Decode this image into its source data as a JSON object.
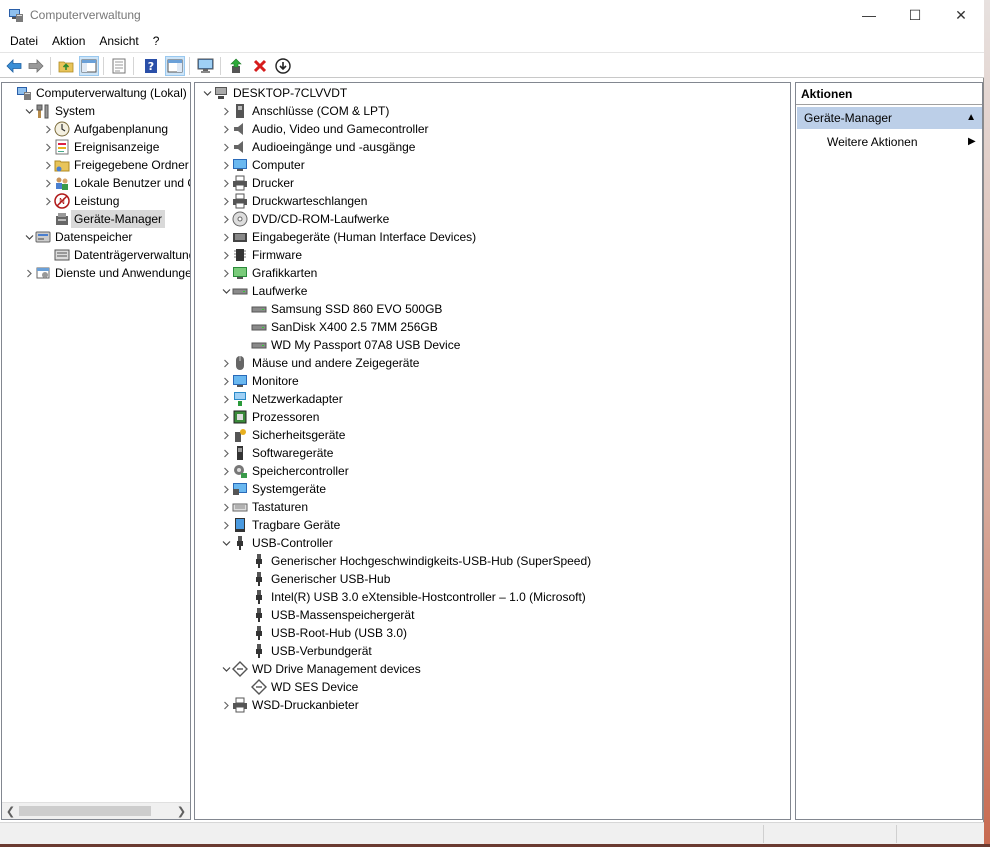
{
  "window": {
    "title": "Computerverwaltung",
    "minimize": "—",
    "maximize": "☐",
    "close": "✕"
  },
  "menu": [
    "Datei",
    "Aktion",
    "Ansicht",
    "?"
  ],
  "left_tree": [
    {
      "label": "Computerverwaltung (Lokal)",
      "icon": "computer-management-icon",
      "expander": "",
      "depth": 0
    },
    {
      "label": "System",
      "icon": "tools-icon",
      "expander": "open",
      "depth": 1
    },
    {
      "label": "Aufgabenplanung",
      "icon": "clock-icon",
      "expander": "closed",
      "depth": 2
    },
    {
      "label": "Ereignisanzeige",
      "icon": "event-viewer-icon",
      "expander": "closed",
      "depth": 2
    },
    {
      "label": "Freigegebene Ordner",
      "icon": "shared-folder-icon",
      "expander": "closed",
      "depth": 2
    },
    {
      "label": "Lokale Benutzer und Gruppen",
      "icon": "users-icon",
      "expander": "closed",
      "depth": 2
    },
    {
      "label": "Leistung",
      "icon": "performance-icon",
      "expander": "closed",
      "depth": 2
    },
    {
      "label": "Geräte-Manager",
      "icon": "device-manager-icon",
      "expander": "",
      "depth": 2,
      "selected": true
    },
    {
      "label": "Datenspeicher",
      "icon": "storage-icon",
      "expander": "open",
      "depth": 1
    },
    {
      "label": "Datenträgerverwaltung",
      "icon": "disk-management-icon",
      "expander": "",
      "depth": 2
    },
    {
      "label": "Dienste und Anwendungen",
      "icon": "services-icon",
      "expander": "closed",
      "depth": 1
    }
  ],
  "device_tree": [
    {
      "label": "DESKTOP-7CLVVDT",
      "icon": "computer-root-icon",
      "expander": "open",
      "depth": 0
    },
    {
      "label": "Anschlüsse (COM & LPT)",
      "icon": "port-icon",
      "expander": "closed",
      "depth": 1
    },
    {
      "label": "Audio, Video und Gamecontroller",
      "icon": "speaker-icon",
      "expander": "closed",
      "depth": 1
    },
    {
      "label": "Audioeingänge und -ausgänge",
      "icon": "speaker-icon",
      "expander": "closed",
      "depth": 1
    },
    {
      "label": "Computer",
      "icon": "monitor-icon",
      "expander": "closed",
      "depth": 1
    },
    {
      "label": "Drucker",
      "icon": "printer-icon",
      "expander": "closed",
      "depth": 1
    },
    {
      "label": "Druckwarteschlangen",
      "icon": "printer-icon",
      "expander": "closed",
      "depth": 1
    },
    {
      "label": "DVD/CD-ROM-Laufwerke",
      "icon": "dvd-icon",
      "expander": "closed",
      "depth": 1
    },
    {
      "label": "Eingabegeräte (Human Interface Devices)",
      "icon": "hid-icon",
      "expander": "closed",
      "depth": 1
    },
    {
      "label": "Firmware",
      "icon": "chip-icon",
      "expander": "closed",
      "depth": 1
    },
    {
      "label": "Grafikkarten",
      "icon": "display-adapter-icon",
      "expander": "closed",
      "depth": 1
    },
    {
      "label": "Laufwerke",
      "icon": "drive-icon",
      "expander": "open",
      "depth": 1
    },
    {
      "label": "Samsung SSD 860 EVO 500GB",
      "icon": "drive-icon",
      "expander": "",
      "depth": 2
    },
    {
      "label": "SanDisk X400 2.5 7MM 256GB",
      "icon": "drive-icon",
      "expander": "",
      "depth": 2
    },
    {
      "label": "WD My Passport 07A8 USB Device",
      "icon": "drive-icon",
      "expander": "",
      "depth": 2
    },
    {
      "label": "Mäuse und andere Zeigegeräte",
      "icon": "mouse-icon",
      "expander": "closed",
      "depth": 1
    },
    {
      "label": "Monitore",
      "icon": "monitor-icon",
      "expander": "closed",
      "depth": 1
    },
    {
      "label": "Netzwerkadapter",
      "icon": "network-icon",
      "expander": "closed",
      "depth": 1
    },
    {
      "label": "Prozessoren",
      "icon": "processor-icon",
      "expander": "closed",
      "depth": 1
    },
    {
      "label": "Sicherheitsgeräte",
      "icon": "security-icon",
      "expander": "closed",
      "depth": 1
    },
    {
      "label": "Softwaregeräte",
      "icon": "software-device-icon",
      "expander": "closed",
      "depth": 1
    },
    {
      "label": "Speichercontroller",
      "icon": "storage-controller-icon",
      "expander": "closed",
      "depth": 1
    },
    {
      "label": "Systemgeräte",
      "icon": "system-device-icon",
      "expander": "closed",
      "depth": 1
    },
    {
      "label": "Tastaturen",
      "icon": "keyboard-icon",
      "expander": "closed",
      "depth": 1
    },
    {
      "label": "Tragbare Geräte",
      "icon": "portable-device-icon",
      "expander": "closed",
      "depth": 1
    },
    {
      "label": "USB-Controller",
      "icon": "usb-icon",
      "expander": "open",
      "depth": 1
    },
    {
      "label": "Generischer Hochgeschwindigkeits-USB-Hub (SuperSpeed)",
      "icon": "usb-icon",
      "expander": "",
      "depth": 2
    },
    {
      "label": "Generischer USB-Hub",
      "icon": "usb-icon",
      "expander": "",
      "depth": 2
    },
    {
      "label": "Intel(R) USB 3.0 eXtensible-Hostcontroller – 1.0 (Microsoft)",
      "icon": "usb-icon",
      "expander": "",
      "depth": 2
    },
    {
      "label": "USB-Massenspeichergerät",
      "icon": "usb-icon",
      "expander": "",
      "depth": 2
    },
    {
      "label": "USB-Root-Hub (USB 3.0)",
      "icon": "usb-icon",
      "expander": "",
      "depth": 2
    },
    {
      "label": "USB-Verbundgerät",
      "icon": "usb-icon",
      "expander": "",
      "depth": 2
    },
    {
      "label": "WD Drive Management devices",
      "icon": "wd-icon",
      "expander": "open",
      "depth": 1
    },
    {
      "label": "WD SES Device",
      "icon": "wd-icon",
      "expander": "",
      "depth": 2
    },
    {
      "label": "WSD-Druckanbieter",
      "icon": "printer-icon",
      "expander": "closed",
      "depth": 1
    }
  ],
  "actions": {
    "header": "Aktionen",
    "group": "Geräte-Manager",
    "item": "Weitere Aktionen"
  },
  "colors": {
    "selection": "#d9d9d9",
    "action_group": "#bccfe8",
    "toolbar_active": "#cde4f7"
  }
}
